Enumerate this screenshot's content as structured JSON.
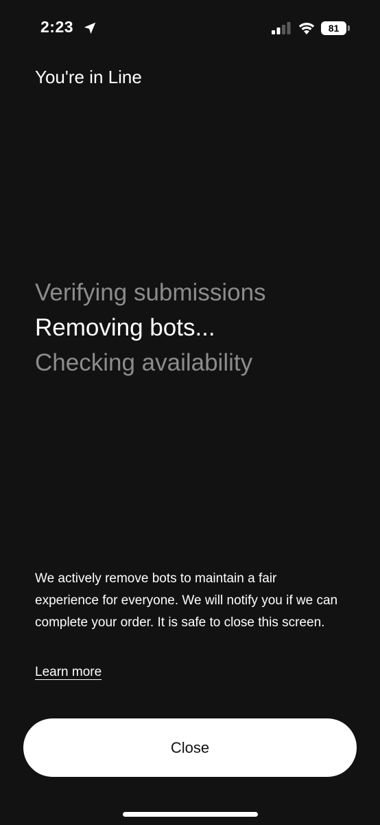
{
  "status_bar": {
    "time": "2:23",
    "battery_level": "81",
    "icons": [
      "location-arrow-icon",
      "cellular-signal-icon",
      "wifi-icon",
      "battery-icon"
    ]
  },
  "header": {
    "title": "You're in Line"
  },
  "steps": [
    {
      "label": "Verifying submissions",
      "state": "done"
    },
    {
      "label": "Removing bots...",
      "state": "active"
    },
    {
      "label": "Checking availability",
      "state": "pending"
    }
  ],
  "info": {
    "body": "We actively remove bots to maintain a fair experience for everyone. We will notify you if we can complete your order. It is safe to close this screen.",
    "learn_more_label": "Learn more"
  },
  "actions": {
    "close_label": "Close"
  },
  "colors": {
    "background": "#121212",
    "text_primary": "#ffffff",
    "text_muted": "#8c8c8c",
    "button_background": "#ffffff",
    "button_text": "#111111"
  }
}
